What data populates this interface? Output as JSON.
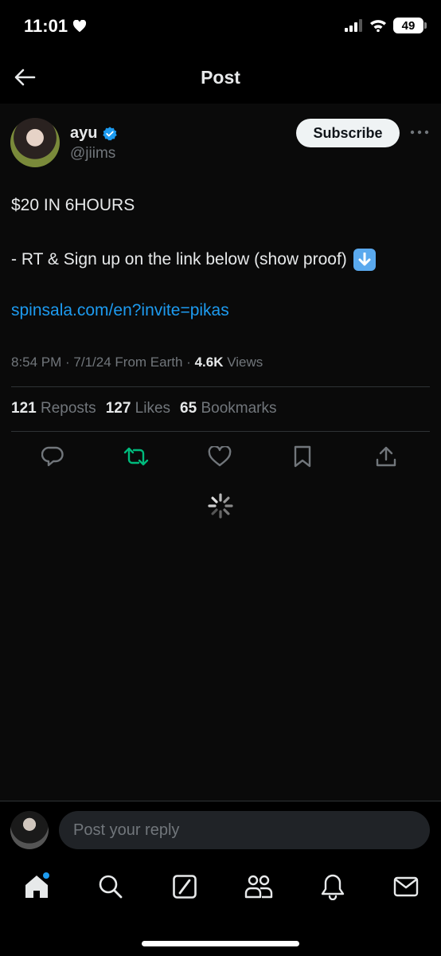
{
  "status_bar": {
    "time": "11:01",
    "battery": "49"
  },
  "header": {
    "title": "Post"
  },
  "post": {
    "author": {
      "name": "ayu",
      "handle": "@jiims"
    },
    "subscribe_label": "Subscribe",
    "text_line1": "$20 IN 6HOURS",
    "text_line2": "- RT & Sign up on the link below (show proof)",
    "link": "spinsala.com/en?invite=pikas",
    "meta": {
      "time": "8:54 PM",
      "date": "7/1/24",
      "location": "From Earth",
      "views_count": "4.6K",
      "views_label": "Views"
    },
    "stats": {
      "reposts_count": "121",
      "reposts_label": "Reposts",
      "likes_count": "127",
      "likes_label": "Likes",
      "bookmarks_count": "65",
      "bookmarks_label": "Bookmarks"
    }
  },
  "reply": {
    "placeholder": "Post your reply"
  },
  "colors": {
    "accent": "#1d9bf0",
    "repost_green": "#00ba7c",
    "background": "#000000"
  },
  "icons": [
    "back-arrow-icon",
    "verified-badge-icon",
    "more-icon",
    "reply-icon",
    "repost-icon",
    "like-icon",
    "bookmark-icon",
    "share-icon",
    "home-icon",
    "search-icon",
    "grok-icon",
    "communities-icon",
    "notifications-icon",
    "messages-icon"
  ]
}
